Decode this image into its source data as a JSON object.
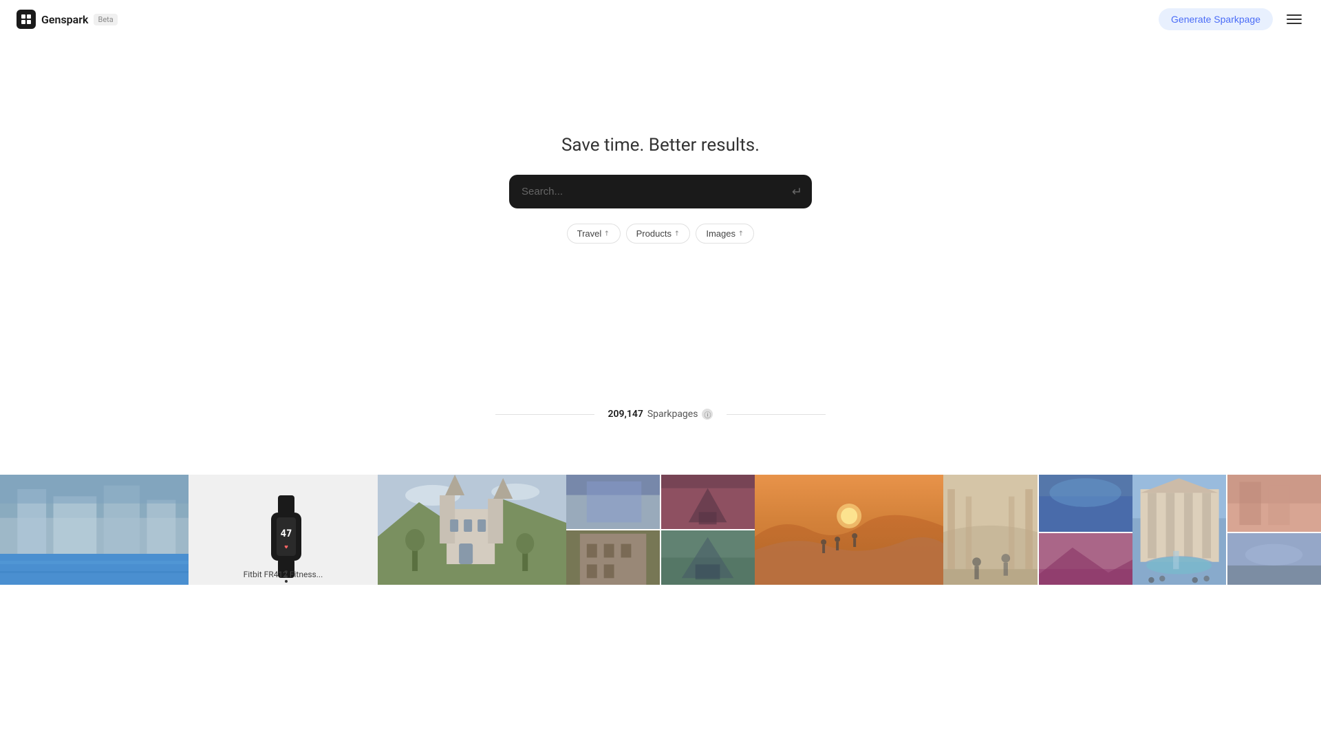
{
  "app": {
    "name": "Genspark",
    "beta_label": "Beta"
  },
  "header": {
    "generate_btn_label": "Generate Sparkpage",
    "menu_icon": "☰"
  },
  "hero": {
    "tagline": "Save time. Better results.",
    "search_placeholder": "Search...",
    "search_hint": "Search ."
  },
  "quick_tags": [
    {
      "label": "Travel",
      "arrow": "↗"
    },
    {
      "label": "Products",
      "arrow": "↗"
    },
    {
      "label": "Images",
      "arrow": "↗"
    }
  ],
  "sparkpages": {
    "count": "209,147",
    "label": "Sparkpages",
    "info_icon": "ⓘ"
  },
  "cards": [
    {
      "id": 1,
      "type": "city",
      "alt": "City plaza"
    },
    {
      "id": 2,
      "type": "product",
      "alt": "Fitbit FR412 Fitness Tracker",
      "caption": "Fitbit FR412 Fitness...",
      "watch_time": "47"
    },
    {
      "id": 3,
      "type": "castle",
      "alt": "Castle with towers"
    },
    {
      "id": 4,
      "type": "collage",
      "alt": "Travel collage"
    },
    {
      "id": 5,
      "type": "desert",
      "alt": "Desert dunes at sunset"
    },
    {
      "id": 6,
      "type": "museum",
      "alt": "Museum gallery"
    },
    {
      "id": 7,
      "type": "fountain",
      "alt": "Trevi Fountain"
    }
  ]
}
